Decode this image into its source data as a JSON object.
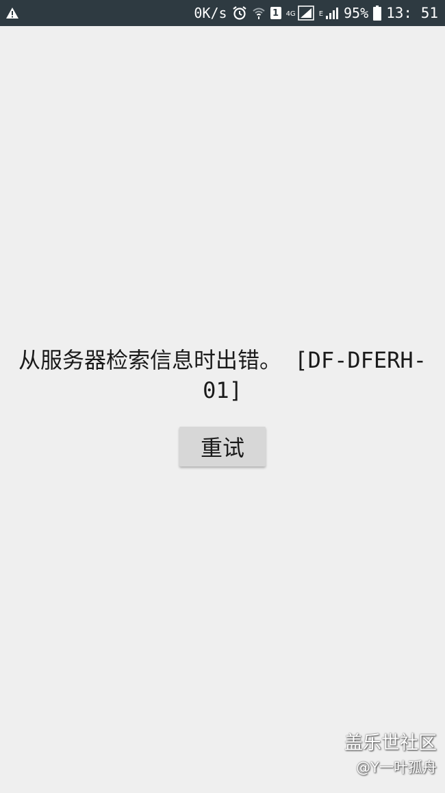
{
  "status_bar": {
    "net_speed": "0K/s",
    "sim_slot": "1",
    "network_type_primary": "4G",
    "network_type_secondary": "E",
    "battery_percent": "95%",
    "time": "13: 51",
    "icons": [
      "warning-icon",
      "alarm-icon",
      "wifi-icon",
      "sim-icon",
      "signal-icon",
      "battery-icon"
    ]
  },
  "main": {
    "error_message": "从服务器检索信息时出错。 [DF-DFERH-01]",
    "retry_label": "重试"
  },
  "watermark": {
    "title": "盖乐世社区",
    "user": "@Y一叶孤舟"
  },
  "colors": {
    "status_bar_bg": "#2e3a41",
    "page_bg": "#efefef",
    "button_bg": "#d7d7d7"
  }
}
